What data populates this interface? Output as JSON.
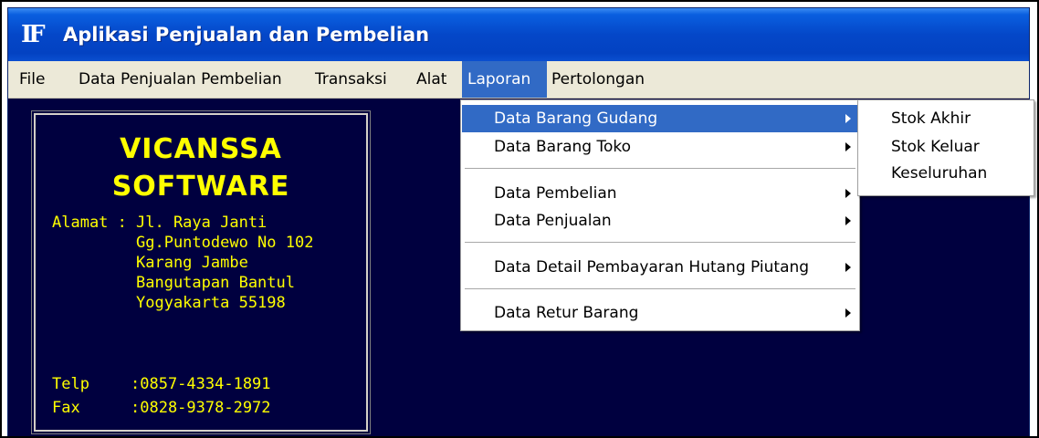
{
  "window": {
    "title": "Aplikasi Penjualan dan Pembelian",
    "icon_text": "IF"
  },
  "menubar": {
    "items": [
      {
        "label": "File"
      },
      {
        "label": "Data Penjualan Pembelian"
      },
      {
        "label": "Transaksi"
      },
      {
        "label": "Alat"
      },
      {
        "label": "Laporan"
      },
      {
        "label": "Pertolongan"
      }
    ],
    "active_item": "Laporan",
    "active_color": "#316ac5"
  },
  "info_panel": {
    "company_line1": "VICANSSA",
    "company_line2": "SOFTWARE",
    "address_label": "Alamat :",
    "address_lines": [
      "Jl. Raya Janti",
      "Gg.Puntodewo No 102",
      "Karang Jambe",
      "Bangutapan Bantul",
      "Yogyakarta 55198"
    ],
    "phone_label": "Telp",
    "phone_value": ":0857-4334-1891",
    "fax_label": "Fax",
    "fax_value": ":0828-9378-2972",
    "text_color": "#ffff00",
    "background_color": "#00003f"
  },
  "laporan_menu": {
    "items": [
      {
        "label": "Data Barang Gudang",
        "highlighted": true
      },
      {
        "label": "Data Barang Toko"
      },
      {
        "label": "Data Pembelian"
      },
      {
        "label": "Data Penjualan"
      },
      {
        "label": "Data Detail Pembayaran Hutang Piutang"
      },
      {
        "label": "Data Retur Barang"
      }
    ]
  },
  "submenu": {
    "items": [
      {
        "label": "Stok Akhir"
      },
      {
        "label": "Stok Keluar"
      },
      {
        "label": "Keseluruhan"
      }
    ]
  }
}
